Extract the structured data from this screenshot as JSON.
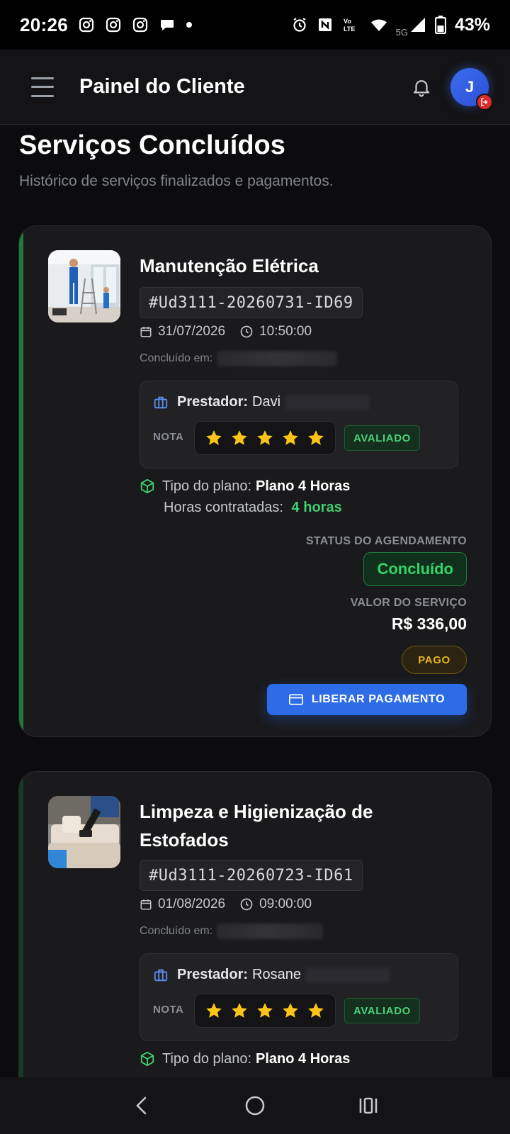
{
  "status_bar": {
    "time": "20:26",
    "battery": "43%",
    "network": "5G"
  },
  "header": {
    "title": "Painel do Cliente",
    "avatar_initial": "J"
  },
  "page": {
    "title": "Serviços Concluídos",
    "subtitle": "Histórico de serviços finalizados e pagamentos."
  },
  "services": [
    {
      "name": "Manutenção Elétrica",
      "code": "#Ud3111-20260731-ID69",
      "date": "31/07/2026",
      "time": "10:50:00",
      "completed_label": "Concluído em:",
      "provider_label": "Prestador:",
      "provider_name": "Davi",
      "rating_label": "NOTA",
      "rating": 5,
      "rated_badge": "AVALIADO",
      "plan_label": "Tipo do plano:",
      "plan_value": "Plano 4 Horas",
      "hours_label": "Horas contratadas:",
      "hours_value": "4 horas",
      "status_label": "STATUS DO AGENDAMENTO",
      "status_value": "Concluído",
      "price_label": "VALOR DO SERVIÇO",
      "price": "R$ 336,00",
      "payment_badge": "PAGO",
      "action_label": "LIBERAR PAGAMENTO"
    },
    {
      "name": "Limpeza e Higienização de Estofados",
      "code": "#Ud3111-20260723-ID61",
      "date": "01/08/2026",
      "time": "09:00:00",
      "completed_label": "Concluído em:",
      "provider_label": "Prestador:",
      "provider_name": "Rosane",
      "rating_label": "NOTA",
      "rating": 5,
      "rated_badge": "AVALIADO",
      "plan_label": "Tipo do plano:",
      "plan_value": "Plano 4 Horas"
    }
  ],
  "colors": {
    "accent_blue": "#2e6be6",
    "success_green": "#34d26b",
    "paid_gold": "#e6b422",
    "star_yellow": "#fcc419"
  }
}
